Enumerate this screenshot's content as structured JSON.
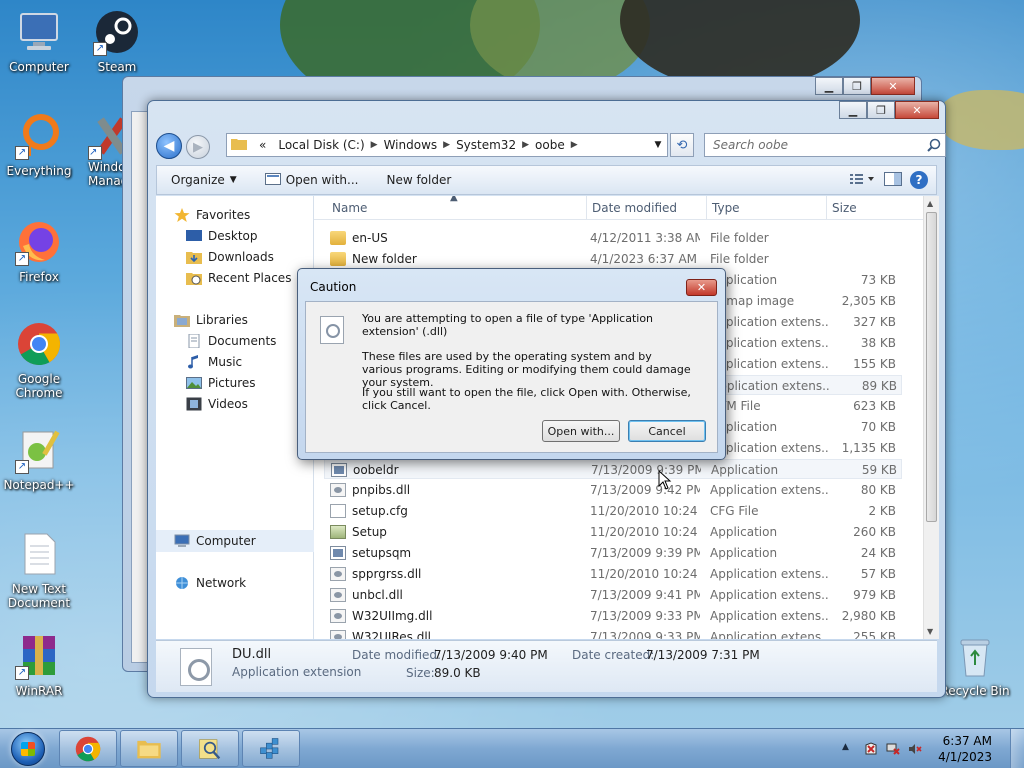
{
  "desktop": {
    "icons": [
      {
        "label": "Computer"
      },
      {
        "label": "Steam"
      },
      {
        "label": "Everything"
      },
      {
        "label": "Windows Manager"
      },
      {
        "label": "Firefox"
      },
      {
        "label": "Google Chrome"
      },
      {
        "label": "Notepad++"
      },
      {
        "label": "New Text Document"
      },
      {
        "label": "WinRAR"
      },
      {
        "label": "Recycle Bin"
      }
    ]
  },
  "explorer": {
    "address": {
      "prefix": "«",
      "segments": [
        "Local Disk (C:)",
        "Windows",
        "System32",
        "oobe"
      ]
    },
    "search_placeholder": "Search oobe",
    "toolbar": {
      "organize": "Organize",
      "open_with": "Open with...",
      "new_folder": "New folder"
    },
    "nav": {
      "favorites": "Favorites",
      "desktop": "Desktop",
      "downloads": "Downloads",
      "recent_places": "Recent Places",
      "libraries": "Libraries",
      "documents": "Documents",
      "music": "Music",
      "pictures": "Pictures",
      "videos": "Videos",
      "computer": "Computer",
      "network": "Network"
    },
    "columns": {
      "name": "Name",
      "date_modified": "Date modified",
      "type": "Type",
      "size": "Size"
    },
    "files": [
      {
        "name": "en-US",
        "date": "4/12/2011 3:38 AM",
        "type": "File folder",
        "size": ""
      },
      {
        "name": "New folder",
        "date": "4/1/2023 6:37 AM",
        "type": "File folder",
        "size": ""
      },
      {
        "name": "",
        "date": "",
        "type": "Application",
        "size": "73 KB"
      },
      {
        "name": "",
        "date": "",
        "type": "Bitmap image",
        "size": "2,305 KB"
      },
      {
        "name": "",
        "date": "",
        "type": "Application extens...",
        "size": "327 KB"
      },
      {
        "name": "",
        "date": "",
        "type": "Application extens...",
        "size": "38 KB"
      },
      {
        "name": "",
        "date": "",
        "type": "Application extens...",
        "size": "155 KB"
      },
      {
        "name": "",
        "date": "",
        "type": "Application extens...",
        "size": "89 KB"
      },
      {
        "name": "",
        "date": "",
        "type": "HTM File",
        "size": "623 KB"
      },
      {
        "name": "",
        "date": "",
        "type": "Application",
        "size": "70 KB"
      },
      {
        "name": "",
        "date": "",
        "type": "Application extens...",
        "size": "1,135 KB"
      },
      {
        "name": "oobeldr",
        "date": "7/13/2009 9:39 PM",
        "type": "Application",
        "size": "59 KB"
      },
      {
        "name": "pnpibs.dll",
        "date": "7/13/2009 9:42 PM",
        "type": "Application extens...",
        "size": "80 KB"
      },
      {
        "name": "setup.cfg",
        "date": "11/20/2010 10:24 ...",
        "type": "CFG File",
        "size": "2 KB"
      },
      {
        "name": "Setup",
        "date": "11/20/2010 10:24 ...",
        "type": "Application",
        "size": "260 KB"
      },
      {
        "name": "setupsqm",
        "date": "7/13/2009 9:39 PM",
        "type": "Application",
        "size": "24 KB"
      },
      {
        "name": "spprgrss.dll",
        "date": "11/20/2010 10:24 ...",
        "type": "Application extens...",
        "size": "57 KB"
      },
      {
        "name": "unbcl.dll",
        "date": "7/13/2009 9:41 PM",
        "type": "Application extens...",
        "size": "979 KB"
      },
      {
        "name": "W32UIImg.dll",
        "date": "7/13/2009 9:33 PM",
        "type": "Application extens...",
        "size": "2,980 KB"
      },
      {
        "name": "W32UIRes.dll",
        "date": "7/13/2009 9:33 PM",
        "type": "Application extens...",
        "size": "255 KB"
      }
    ],
    "details": {
      "filename": "DU.dll",
      "filetype": "Application extension",
      "date_modified_label": "Date modified:",
      "date_modified": "7/13/2009 9:40 PM",
      "date_created_label": "Date created:",
      "date_created": "7/13/2009 7:31 PM",
      "size_label": "Size:",
      "size": "89.0 KB"
    }
  },
  "dialog": {
    "title": "Caution",
    "close_glyph": "✕",
    "line1": "You are attempting to open a file of type 'Application extension' (.dll)",
    "line2": "These files are used by the operating system and by various programs. Editing or modifying them could damage your system.",
    "line3": "If you still want to open the file, click Open with. Otherwise, click Cancel.",
    "open_with": "Open with...",
    "cancel": "Cancel"
  },
  "taskbar": {
    "time": "6:37 AM",
    "date": "4/1/2023"
  }
}
